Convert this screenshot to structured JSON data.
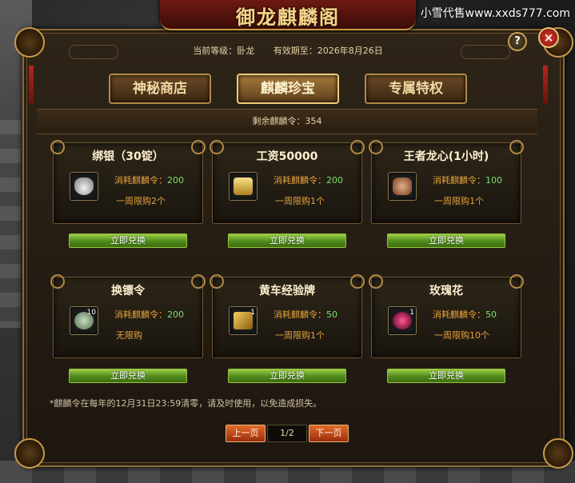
{
  "watermark": "小雪代售www.xxds777.com",
  "window": {
    "title": "御龙麒麟阁"
  },
  "info": {
    "level": "当前等级：卧龙",
    "expiry": "有效期至：2026年8月26日"
  },
  "tabs": [
    {
      "label": "神秘商店",
      "active": false
    },
    {
      "label": "麒麟珍宝",
      "active": true
    },
    {
      "label": "专属特权",
      "active": false
    }
  ],
  "remaining": "剩余麒麟令：354",
  "items": [
    {
      "name": "绑银（30锭）",
      "cost_label": "消耗麒麟令：",
      "cost": "200",
      "limit": "一周限购2个",
      "icon": "silver-ingot-icon",
      "count": ""
    },
    {
      "name": "工资50000",
      "cost_label": "消耗麒麟令：",
      "cost": "200",
      "limit": "一周限购1个",
      "icon": "gold-scroll-icon",
      "count": ""
    },
    {
      "name": "王者龙心(1小时)",
      "cost_label": "消耗麒麟令：",
      "cost": "100",
      "limit": "一周限购1个",
      "icon": "dragon-heart-icon",
      "count": ""
    },
    {
      "name": "换镖令",
      "cost_label": "消耗麒麟令：",
      "cost": "200",
      "limit": "无限购",
      "icon": "jade-token-icon",
      "count": "10"
    },
    {
      "name": "黄车经验牌",
      "cost_label": "消耗麒麟令：",
      "cost": "50",
      "limit": "一周限购1个",
      "icon": "cart-plaque-icon",
      "count": "1"
    },
    {
      "name": "玫瑰花",
      "cost_label": "消耗麒麟令：",
      "cost": "50",
      "limit": "一周限购10个",
      "icon": "rose-icon",
      "count": "1"
    }
  ],
  "exchange_label": "立即兑换",
  "notice": "*麒麟令在每年的12月31日23:59清零，请及时使用，以免造成损失。",
  "pagination": {
    "prev": "上一页",
    "page": "1/2",
    "next": "下一页"
  },
  "buttons": {
    "help": "?",
    "close": "×"
  }
}
